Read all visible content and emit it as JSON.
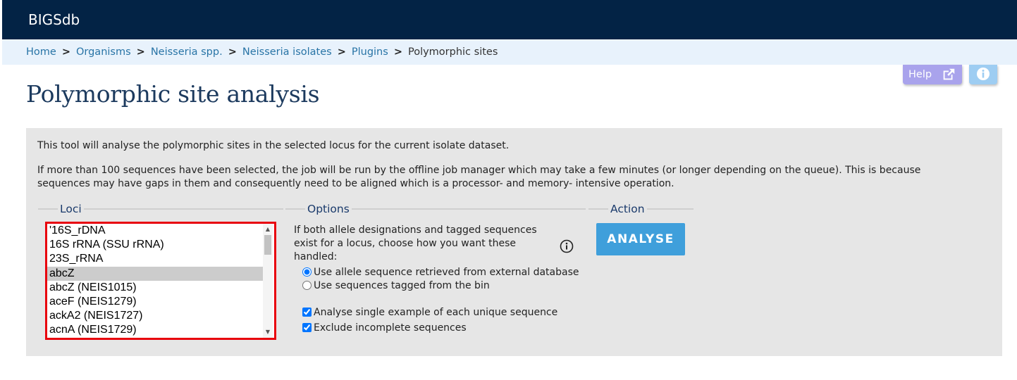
{
  "app": {
    "brand": "BIGSdb"
  },
  "breadcrumb": [
    {
      "label": "Home"
    },
    {
      "label": "Organisms"
    },
    {
      "label": "Neisseria spp."
    },
    {
      "label": "Neisseria isolates"
    },
    {
      "label": "Plugins"
    }
  ],
  "breadcrumb_current": "Polymorphic sites",
  "breadcrumb_separator": ">",
  "header_buttons": {
    "help_label": "Help"
  },
  "page": {
    "title": "Polymorphic site analysis"
  },
  "intro": {
    "p1": "This tool will analyse the polymorphic sites in the selected locus for the current isolate dataset.",
    "p2": "If more than 100 sequences have been selected, the job will be run by the offline job manager which may take a few minutes (or longer depending on the queue). This is because sequences may have gaps in them and consequently need to be aligned which is a processor- and memory- intensive operation."
  },
  "loci": {
    "legend": "Loci",
    "items": [
      "'16S_rDNA",
      "16S rRNA (SSU rRNA)",
      "23S_rRNA",
      "abcZ",
      "abcZ (NEIS1015)",
      "aceF (NEIS1279)",
      "ackA2 (NEIS1727)",
      "acnA (NEIS1729)"
    ],
    "selected_index": 3
  },
  "options": {
    "legend": "Options",
    "description": "If both allele designations and tagged sequences exist for a locus, choose how you want these handled:",
    "radio": [
      {
        "label": "Use allele sequence retrieved from external database",
        "checked": true
      },
      {
        "label": "Use sequences tagged from the bin",
        "checked": false
      }
    ],
    "checkbox": [
      {
        "label": "Analyse single example of each unique sequence",
        "checked": true
      },
      {
        "label": "Exclude incomplete sequences",
        "checked": true
      }
    ]
  },
  "action": {
    "legend": "Action",
    "button_label": "ANALYSE"
  },
  "colors": {
    "topbar": "#032345",
    "breadcrumb_bg": "#e8f2fc",
    "link": "#2874a6",
    "help_button": "#a9a3ec",
    "info_button": "#9ecdf2",
    "analyse_button": "#3f9fdb",
    "highlight_border": "#e8000d",
    "panel_bg": "#e6e6e6"
  }
}
